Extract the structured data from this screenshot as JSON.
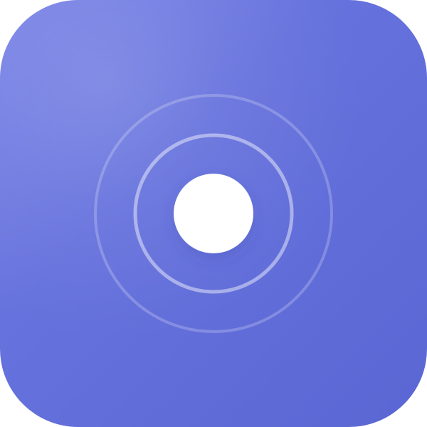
{
  "app_icon": {
    "name": "concentric-signal-icon",
    "background": {
      "top_left": "#7a84e6",
      "middle": "#6672dd",
      "bottom_right": "#5a66d3"
    },
    "rings": [
      {
        "name": "outer-ring",
        "color": "rgba(255,255,255,0.22)"
      },
      {
        "name": "middle-ring",
        "color": "rgba(255,255,255,0.45)"
      }
    ],
    "center_dot": {
      "name": "center-dot",
      "color": "#ffffff"
    }
  }
}
